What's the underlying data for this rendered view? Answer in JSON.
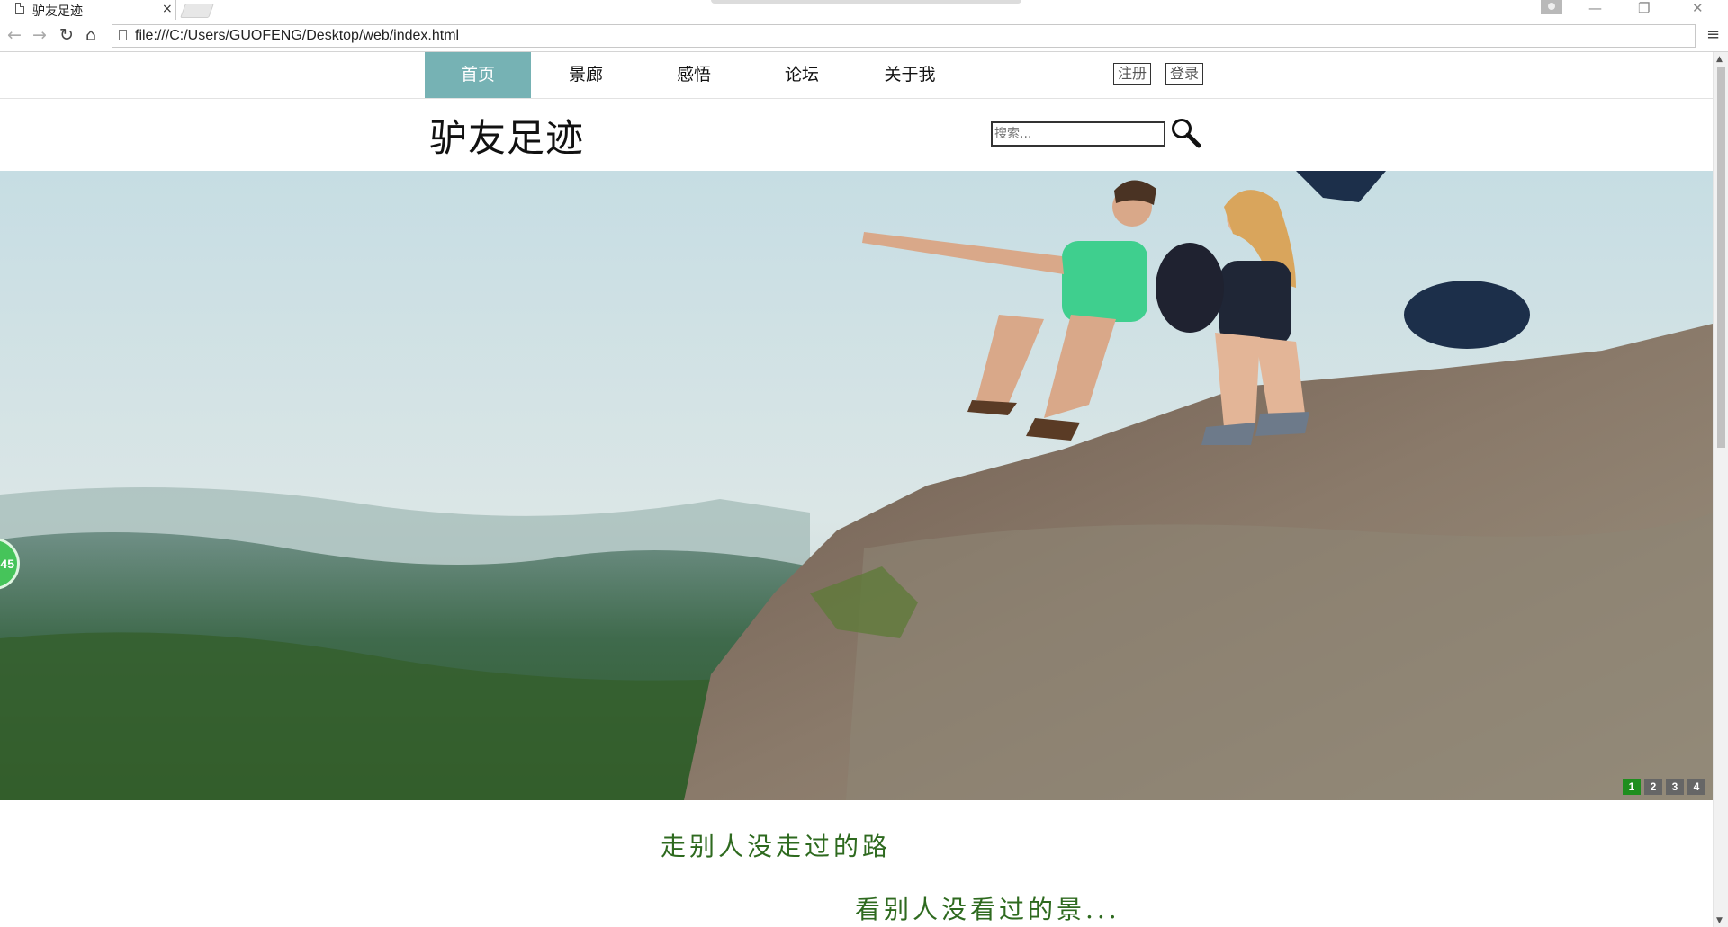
{
  "browser": {
    "tab_title": "驴友足迹",
    "tab_close": "×",
    "url": "file:///C:/Users/GUOFENG/Desktop/web/index.html",
    "back_glyph": "←",
    "forward_glyph": "→",
    "reload_glyph": "↻",
    "home_glyph": "⌂",
    "star_glyph": "☆",
    "menu_glyph": "≡",
    "minimize_glyph": "—",
    "restore_glyph": "❐",
    "close_glyph": "✕"
  },
  "nav": {
    "items": [
      {
        "label": "首页",
        "active": true
      },
      {
        "label": "景廊"
      },
      {
        "label": "感悟"
      },
      {
        "label": "论坛"
      },
      {
        "label": "关于我"
      }
    ],
    "register_label": "注册",
    "login_label": "登录"
  },
  "header": {
    "logo_text": "驴友足迹",
    "search_placeholder": "搜索..."
  },
  "hero": {
    "slides": [
      "1",
      "2",
      "3",
      "4"
    ],
    "active_slide": "1",
    "side_badge": "45"
  },
  "slogans": {
    "line1": "走别人没走过的路",
    "line2": "看别人没看过的景..."
  },
  "colors": {
    "nav_active": "#76b2b4",
    "slogan": "#2e6a1f",
    "slider_active": "#1e8e1e"
  }
}
